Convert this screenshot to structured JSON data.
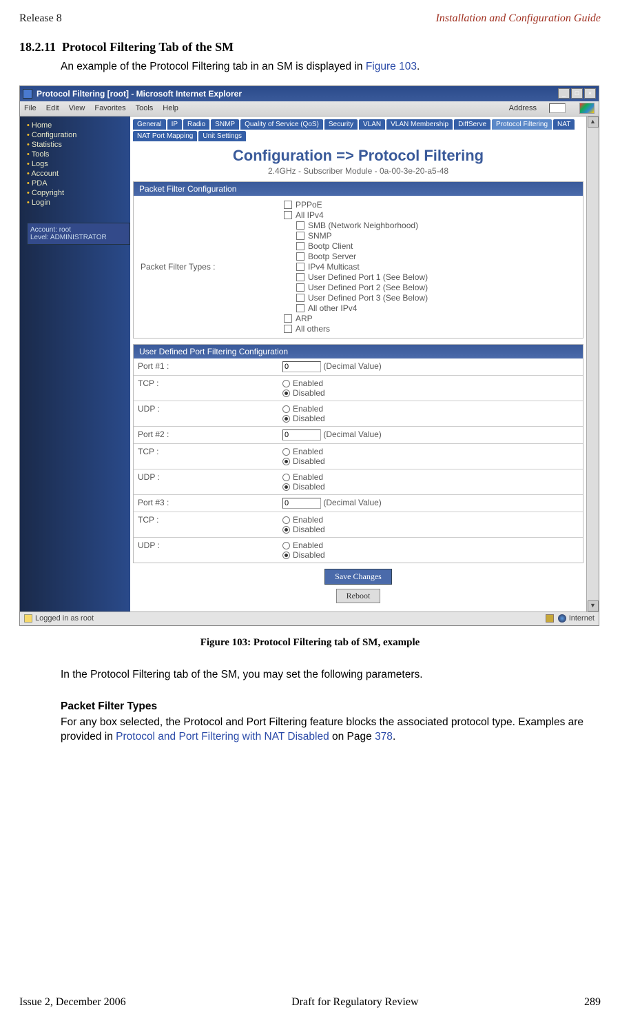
{
  "header": {
    "left": "Release 8",
    "right": "Installation and Configuration Guide"
  },
  "section": {
    "num": "18.2.11",
    "title": "Protocol Filtering Tab of the SM",
    "intro_1": "An example of the Protocol Filtering tab in an SM is displayed in ",
    "intro_link": "Figure 103",
    "intro_2": "."
  },
  "figure_caption": "Figure 103: Protocol Filtering tab of SM, example",
  "para2": "In the Protocol Filtering tab of the SM, you may set the following parameters.",
  "pft_heading": "Packet Filter Types",
  "pft_text_1": "For any box selected, the Protocol and Port Filtering feature blocks the associated protocol type. Examples are provided in ",
  "pft_link": "Protocol and Port Filtering with NAT Disabled",
  "pft_text_2": " on Page ",
  "pft_page": "378",
  "pft_text_3": ".",
  "footer": {
    "left": "Issue 2, December 2006",
    "center": "Draft for Regulatory Review",
    "right": "289"
  },
  "browser": {
    "title": "Protocol Filtering [root] - Microsoft Internet Explorer",
    "menu": [
      "File",
      "Edit",
      "View",
      "Favorites",
      "Tools",
      "Help"
    ],
    "address_label": "Address"
  },
  "sidebar": {
    "items": [
      "Home",
      "Configuration",
      "Statistics",
      "Tools",
      "Logs",
      "Account",
      "PDA",
      "Copyright",
      "Login"
    ],
    "footer_top": "Account: root",
    "footer_bot": "Level: ADMINISTRATOR"
  },
  "tabs": {
    "row1": [
      "General",
      "IP",
      "Radio",
      "SNMP",
      "Quality of Service (QoS)",
      "Security",
      "VLAN",
      "VLAN Membership",
      "DiffServe",
      "Protocol Filtering"
    ],
    "row2": [
      "NAT",
      "NAT Port Mapping",
      "Unit Settings"
    ]
  },
  "page_title": {
    "main": "Configuration => Protocol Filtering",
    "sub": "2.4GHz - Subscriber Module - 0a-00-3e-20-a5-48"
  },
  "panel1": {
    "head": "Packet Filter Configuration",
    "label": "Packet Filter Types :",
    "items": [
      {
        "t": "PPPoE",
        "sub": false
      },
      {
        "t": "All IPv4",
        "sub": false
      },
      {
        "t": "SMB (Network Neighborhood)",
        "sub": true
      },
      {
        "t": "SNMP",
        "sub": true
      },
      {
        "t": "Bootp Client",
        "sub": true
      },
      {
        "t": "Bootp Server",
        "sub": true
      },
      {
        "t": "IPv4 Multicast",
        "sub": true
      },
      {
        "t": "User Defined Port 1 (See Below)",
        "sub": true
      },
      {
        "t": "User Defined Port 2 (See Below)",
        "sub": true
      },
      {
        "t": "User Defined Port 3 (See Below)",
        "sub": true
      },
      {
        "t": "All other IPv4",
        "sub": true
      },
      {
        "t": "ARP",
        "sub": false
      },
      {
        "t": "All others",
        "sub": false
      }
    ]
  },
  "panel2": {
    "head": "User Defined Port Filtering Configuration",
    "decimal": "(Decimal Value)",
    "enabled": "Enabled",
    "disabled": "Disabled",
    "rows": [
      {
        "label": "Port #1 :",
        "val": "0"
      },
      {
        "label": "TCP :"
      },
      {
        "label": "UDP :"
      },
      {
        "label": "Port #2 :",
        "val": "0"
      },
      {
        "label": "TCP :"
      },
      {
        "label": "UDP :"
      },
      {
        "label": "Port #3 :",
        "val": "0"
      },
      {
        "label": "TCP :"
      },
      {
        "label": "UDP :"
      }
    ]
  },
  "buttons": {
    "save": "Save Changes",
    "reboot": "Reboot"
  },
  "statusbar": {
    "left": "Logged in as root",
    "right": "Internet"
  }
}
